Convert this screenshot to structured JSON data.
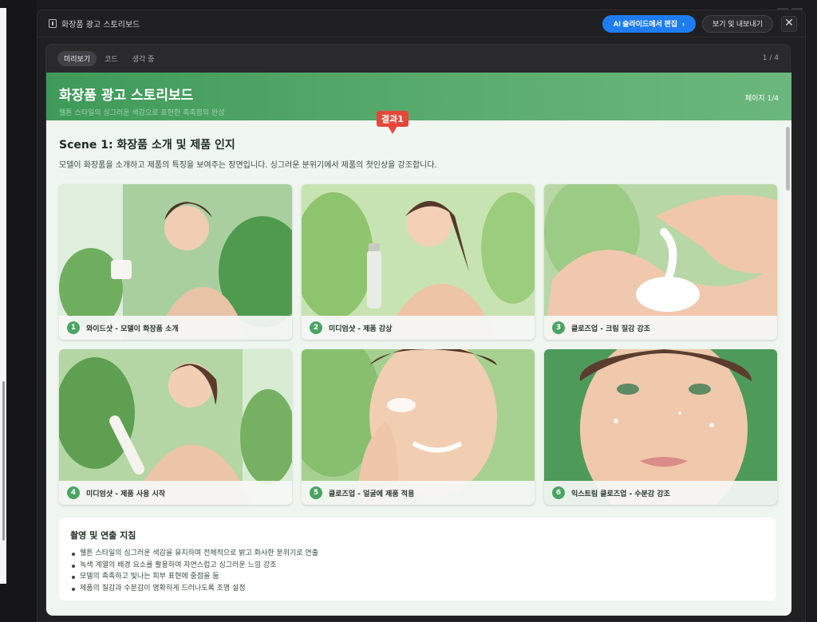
{
  "window": {
    "title": "화장품 광고 스토리보드",
    "ai_button": "AI 슬라이드에서 편집",
    "export_button": "보기 및 내보내기",
    "close_glyph": "✕"
  },
  "tabs": [
    {
      "label": "미리보기",
      "active": true
    },
    {
      "label": "코드",
      "active": false
    },
    {
      "label": "생각 중",
      "active": false
    }
  ],
  "page_count": "1 / 4",
  "slide": {
    "title": "화장품 광고 스토리보드",
    "subtitle": "웰톤 스타일의 싱그러운 색감으로 표현한 촉촉함의 완성",
    "page": "페이지 1/4",
    "badge": "결과1",
    "scene_title": "Scene 1: 화장품 소개 및 제품 인지",
    "scene_desc": "모델이 화장품을 소개하고 제품의 특징을 보여주는 장면입니다. 싱그러운 분위기에서 제품의 첫인상을 강조합니다.",
    "cards": [
      {
        "num": "1",
        "caption": "와이드샷 - 모델이 화장품 소개"
      },
      {
        "num": "2",
        "caption": "미디엄샷 - 제품 감상"
      },
      {
        "num": "3",
        "caption": "클로즈업 - 크림 질감 강조"
      },
      {
        "num": "4",
        "caption": "미디엄샷 - 제품 사용 시작"
      },
      {
        "num": "5",
        "caption": "클로즈업 - 얼굴에 제품 적용"
      },
      {
        "num": "6",
        "caption": "익스트림 클로즈업 - 수분감 강조"
      }
    ],
    "guide": {
      "title": "촬영 및 연출 지침",
      "items": [
        "웰튼 스타일의 싱그러운 색감을 유지하며 전체적으로 밝고 화사한 분위기로 연출",
        "녹색 계열의 배경 요소를 활용하여 자연스럽고 싱그러운 느낌 강조",
        "모델의 촉촉하고 빛나는 피부 표현에 중점을 둠",
        "제품의 질감과 수분감이 명확하게 드러나도록 조명 설정"
      ]
    }
  },
  "colors": {
    "accent_blue": "#1f7cf0",
    "header_green": "#4fa465",
    "badge_red": "#e5483a",
    "number_green": "#4aa463"
  }
}
